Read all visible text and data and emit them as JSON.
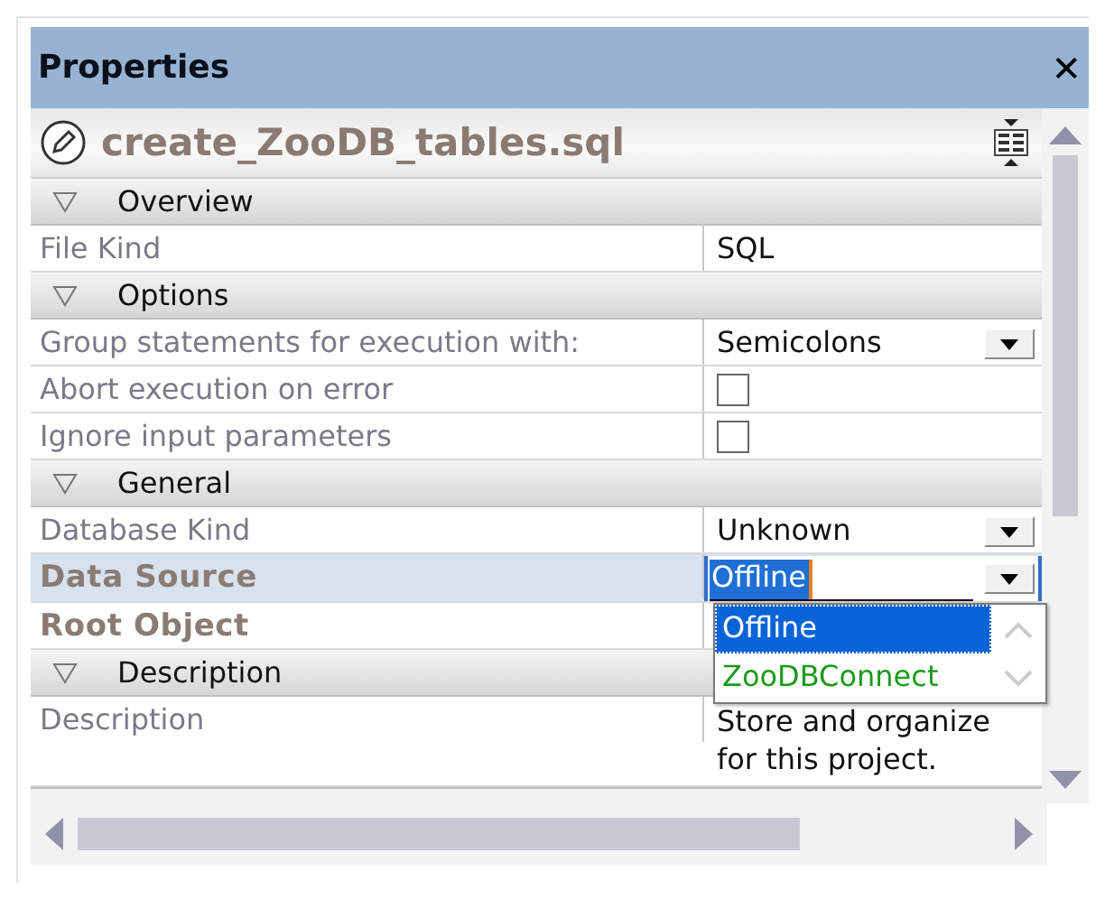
{
  "panel": {
    "title": "Properties",
    "close": "✕"
  },
  "header": {
    "file_name": "create_ZooDB_tables.sql"
  },
  "sections": [
    {
      "title": "Overview",
      "expanded": true,
      "rows": [
        {
          "kind": "text",
          "label": "File Kind",
          "bold": false,
          "selected": false,
          "value": "SQL"
        }
      ]
    },
    {
      "title": "Options",
      "expanded": true,
      "rows": [
        {
          "kind": "dropdown",
          "label": "Group statements for execution with:",
          "bold": false,
          "selected": false,
          "value": "Semicolons"
        },
        {
          "kind": "checkbox",
          "label": "Abort execution on error",
          "bold": false,
          "selected": false,
          "checked": false
        },
        {
          "kind": "checkbox",
          "label": "Ignore input parameters",
          "bold": false,
          "selected": false,
          "checked": false
        }
      ]
    },
    {
      "title": "General",
      "expanded": true,
      "rows": [
        {
          "kind": "dropdown",
          "label": "Database Kind",
          "bold": false,
          "selected": false,
          "value": "Unknown"
        },
        {
          "kind": "editing",
          "label": "Data Source",
          "bold": true,
          "selected": true,
          "value": "Offline",
          "options": [
            {
              "label": "Offline",
              "selected": true,
              "color": "#ffffff"
            },
            {
              "label": "ZooDBConnect",
              "selected": false,
              "color": "#1a9a1a"
            }
          ]
        },
        {
          "kind": "empty",
          "label": "Root Object",
          "bold": true,
          "selected": false
        }
      ]
    },
    {
      "title": "Description",
      "expanded": true,
      "rows": [
        {
          "kind": "multiline",
          "label": "Description",
          "bold": false,
          "selected": false,
          "value": "Store and organize for this project."
        }
      ]
    }
  ]
}
